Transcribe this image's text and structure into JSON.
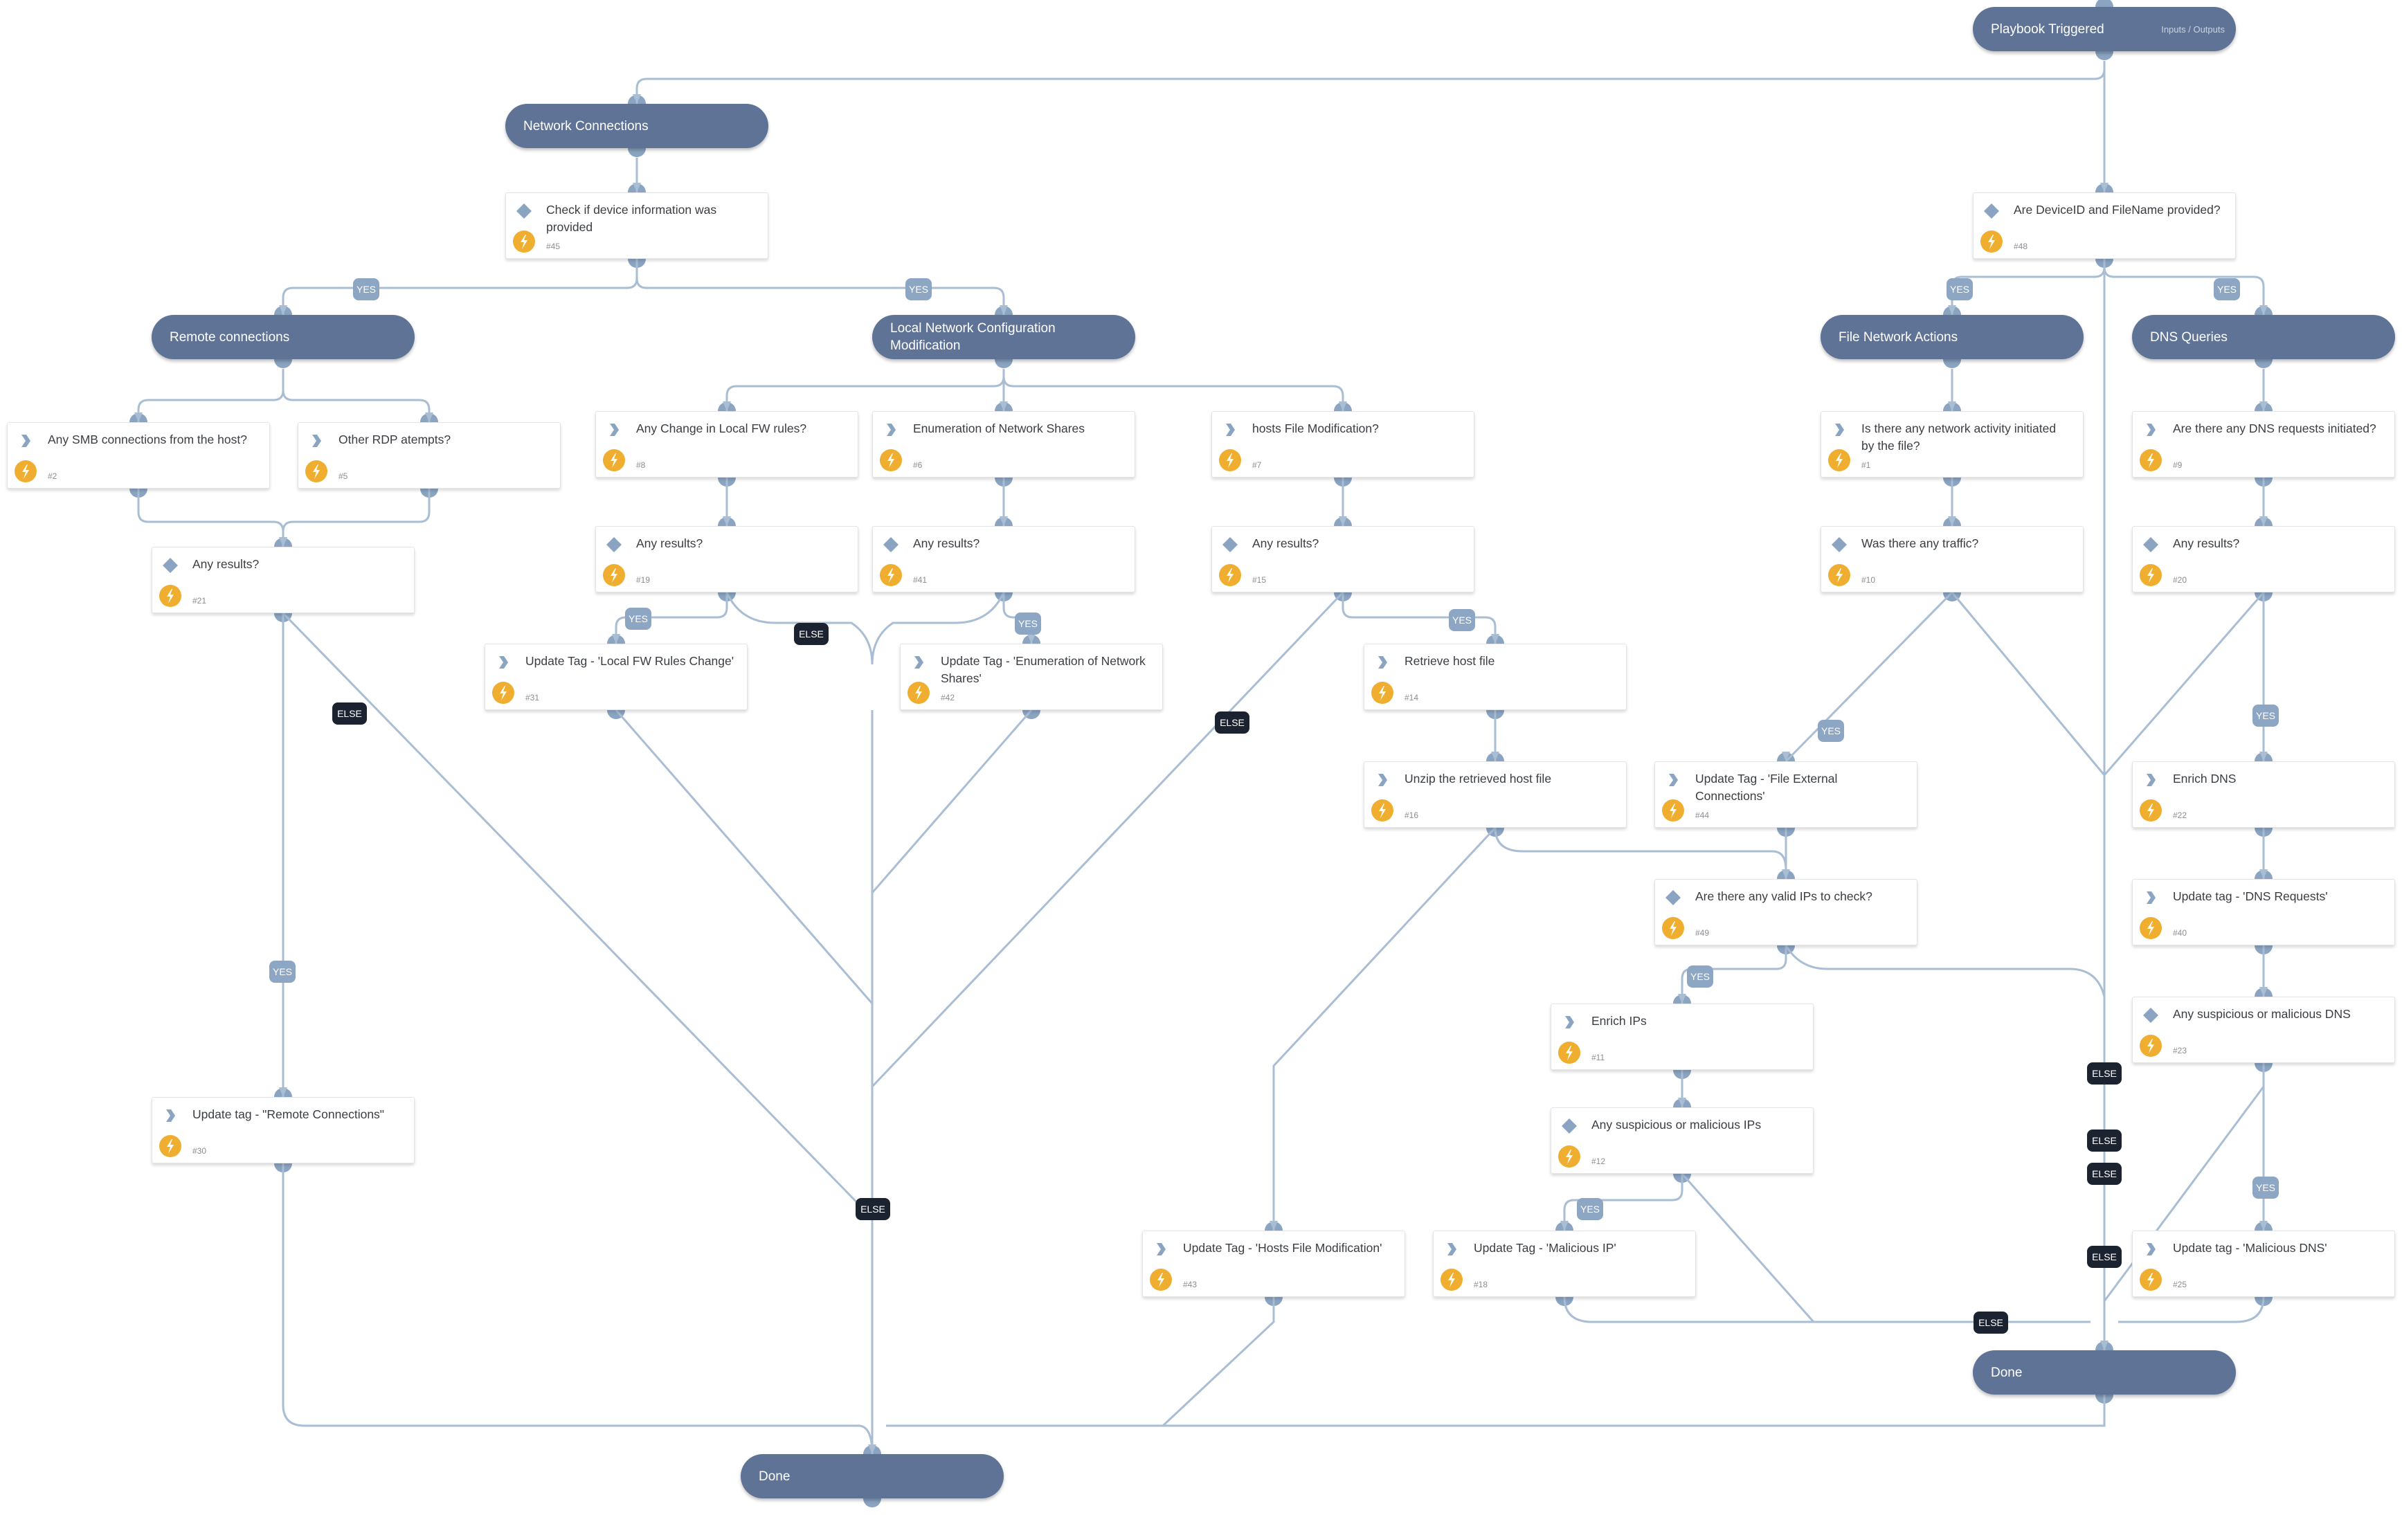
{
  "sections": {
    "playbook_triggered": {
      "label": "Playbook Triggered",
      "io_link": "Inputs / Outputs"
    },
    "network_connections": {
      "label": "Network Connections"
    },
    "remote_connections": {
      "label": "Remote connections"
    },
    "local_network_config": {
      "label": "Local Network Configuration Modification"
    },
    "file_network_actions": {
      "label": "File Network Actions"
    },
    "dns_queries": {
      "label": "DNS Queries"
    },
    "done_left": {
      "label": "Done"
    },
    "done_right": {
      "label": "Done"
    }
  },
  "tasks": {
    "t45": {
      "type": "condition",
      "title": "Check if device information was provided",
      "id": "#45"
    },
    "t48": {
      "type": "condition",
      "title": "Are DeviceID and FileName provided?",
      "id": "#48"
    },
    "t2": {
      "type": "playbook",
      "title": "Any SMB connections from the host?",
      "id": "#2"
    },
    "t5": {
      "type": "playbook",
      "title": "Other RDP atempts?",
      "id": "#5"
    },
    "t21": {
      "type": "condition",
      "title": "Any results?",
      "id": "#21"
    },
    "t30": {
      "type": "playbook",
      "title": "Update tag - \"Remote Connections\"",
      "id": "#30"
    },
    "t8": {
      "type": "playbook",
      "title": "Any Change in Local FW rules?",
      "id": "#8"
    },
    "t6": {
      "type": "playbook",
      "title": "Enumeration of Network Shares",
      "id": "#6"
    },
    "t7": {
      "type": "playbook",
      "title": "hosts File Modification?",
      "id": "#7"
    },
    "t19": {
      "type": "condition",
      "title": "Any results?",
      "id": "#19"
    },
    "t41": {
      "type": "condition",
      "title": "Any results?",
      "id": "#41"
    },
    "t15": {
      "type": "condition",
      "title": "Any results?",
      "id": "#15"
    },
    "t31": {
      "type": "playbook",
      "title": "Update Tag - 'Local FW Rules Change'",
      "id": "#31"
    },
    "t42": {
      "type": "playbook",
      "title": "Update Tag - 'Enumeration of Network Shares'",
      "id": "#42"
    },
    "t14": {
      "type": "playbook",
      "title": "Retrieve host file",
      "id": "#14"
    },
    "t16": {
      "type": "playbook",
      "title": "Unzip the retrieved host file",
      "id": "#16"
    },
    "t43": {
      "type": "playbook",
      "title": "Update Tag - 'Hosts File Modification'",
      "id": "#43"
    },
    "t1": {
      "type": "playbook",
      "title": "Is there any network activity initiated by the file?",
      "id": "#1"
    },
    "t10": {
      "type": "condition",
      "title": "Was there any traffic?",
      "id": "#10"
    },
    "t44": {
      "type": "playbook",
      "title": "Update Tag - 'File External Connections'",
      "id": "#44"
    },
    "t49": {
      "type": "condition",
      "title": "Are there any valid IPs to check?",
      "id": "#49"
    },
    "t11": {
      "type": "playbook",
      "title": "Enrich IPs",
      "id": "#11"
    },
    "t12": {
      "type": "condition",
      "title": "Any suspicious or malicious IPs",
      "id": "#12"
    },
    "t18": {
      "type": "playbook",
      "title": "Update Tag - 'Malicious IP'",
      "id": "#18"
    },
    "t9": {
      "type": "playbook",
      "title": "Are there any DNS requests initiated?",
      "id": "#9"
    },
    "t20": {
      "type": "condition",
      "title": "Any results?",
      "id": "#20"
    },
    "t22": {
      "type": "playbook",
      "title": "Enrich DNS",
      "id": "#22"
    },
    "t40": {
      "type": "playbook",
      "title": "Update tag - 'DNS Requests'",
      "id": "#40"
    },
    "t23": {
      "type": "condition",
      "title": "Any suspicious or malicious DNS",
      "id": "#23"
    },
    "t25": {
      "type": "playbook",
      "title": "Update tag - 'Malicious DNS'",
      "id": "#25"
    }
  },
  "edge_labels": {
    "yes": "YES",
    "else": "ELSE"
  },
  "colors": {
    "section": "#5f7396",
    "edge": "#a9bdd3",
    "port": "#8aa4c1",
    "yes_label": "#8ca6c3",
    "else_label": "#1b2230",
    "automation_badge": "#f0ae31"
  }
}
